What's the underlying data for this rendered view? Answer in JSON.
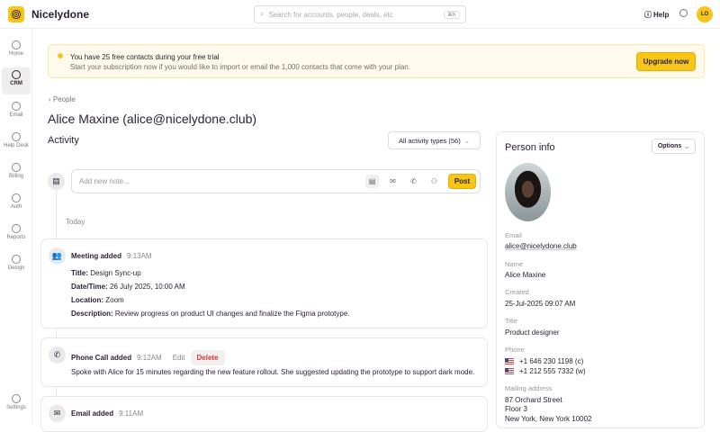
{
  "header": {
    "brand": "Nicelydone",
    "search_placeholder": "Search for accounts, people, deals, etc",
    "search_shortcut": "⌘K",
    "help": "Help",
    "avatar": "LO"
  },
  "sidebar": [
    {
      "label": "Home",
      "icon": "home-icon"
    },
    {
      "label": "CRM",
      "icon": "crm-icon"
    },
    {
      "label": "Email",
      "icon": "email-icon"
    },
    {
      "label": "Help Desk",
      "icon": "help-desk-icon"
    },
    {
      "label": "Billing",
      "icon": "billing-icon"
    },
    {
      "label": "Auth",
      "icon": "auth-icon"
    },
    {
      "label": "Reports",
      "icon": "reports-icon"
    },
    {
      "label": "Design",
      "icon": "design-icon"
    },
    {
      "label": "Settings",
      "icon": "settings-icon"
    }
  ],
  "banner": {
    "title": "You have 25 free contacts during your free trial",
    "text": "Start your subscription now if you would like to import or email the 1,000 contacts that come with your plan.",
    "button": "Upgrade now"
  },
  "breadcrumb": "People",
  "page_title": "Alice Maxine (alice@nicelydone.club)",
  "activity": {
    "heading": "Activity",
    "filter": "All activity types (56)",
    "note_placeholder": "Add new note...",
    "post": "Post",
    "today": "Today",
    "items": [
      {
        "type": "Meeting added",
        "time": "9:13AM",
        "fields": [
          {
            "k": "Title:",
            "v": "Design Sync-up"
          },
          {
            "k": "Date/Time:",
            "v": "26 July 2025, 10:00 AM"
          },
          {
            "k": "Location:",
            "v": "Zoom"
          },
          {
            "k": "Description:",
            "v": "Review progress on product UI changes and finalize the Figma prototype."
          }
        ]
      },
      {
        "type": "Phone Call added",
        "time": "9:12AM",
        "edit": "Edit",
        "delete": "Delete",
        "body": "Spoke with Alice for 15 minutes regarding the new feature rollout. She suggested updating the prototype to support dark mode."
      },
      {
        "type": "Email added",
        "time": "9:11AM"
      }
    ]
  },
  "person": {
    "title": "Person info",
    "options": "Options",
    "email_label": "Email",
    "email": "alice@nicelydone.club",
    "name_label": "Name",
    "name": "Alice Maxine",
    "created_label": "Created",
    "created": "25-Jul-2025 09:07 AM",
    "title_label": "Title",
    "job_title": "Product designer",
    "phone_label": "Phone",
    "phones": [
      "+1 646 230 1198 (c)",
      "+1 212 555 7332 (w)"
    ],
    "address_label": "Mailing address",
    "address": [
      "87 Orchard Street",
      "Floor 3",
      "New York, New York  10002"
    ]
  }
}
